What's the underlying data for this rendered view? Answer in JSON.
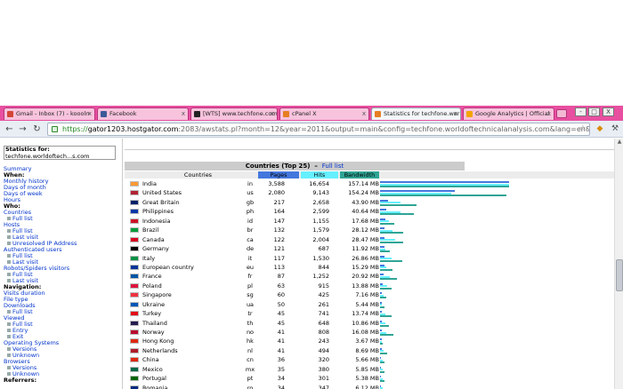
{
  "browser": {
    "tabs": [
      {
        "label": "Gmail - Inbox (7) - koooln",
        "icon": "gmail-icon",
        "color": "#d44638"
      },
      {
        "label": "Facebook",
        "icon": "facebook-icon",
        "color": "#3b5998"
      },
      {
        "label": "[WTS] www.techfone.com",
        "icon": "forum-icon",
        "color": "#222222"
      },
      {
        "label": "cPanel X",
        "icon": "cpanel-icon",
        "color": "#e67e22"
      },
      {
        "label": "Statistics for techfone.worl",
        "icon": "awstats-icon",
        "color": "#e67e22",
        "active": true
      },
      {
        "label": "Google Analytics | Official",
        "icon": "analytics-icon",
        "color": "#f4a400"
      }
    ],
    "url": {
      "scheme": "https://",
      "host": "gator1203.hostgator.com",
      "rest": ":2083/awstats.pl?month=12&year=2011&output=main&config=techfone.worldoftechnicalanalysis.com&lang=en&framename=in"
    },
    "window_controls": [
      "-",
      "□",
      "X"
    ]
  },
  "sidebar": {
    "stats_for_label": "Statistics for:",
    "stats_for_site": "techfone.worldoftech...s.com",
    "items": [
      {
        "text": "Summary",
        "type": "a"
      },
      {
        "text": "When:",
        "type": "h"
      },
      {
        "text": "Monthly history",
        "type": "a"
      },
      {
        "text": "Days of month",
        "type": "a"
      },
      {
        "text": "Days of week",
        "type": "a"
      },
      {
        "text": "Hours",
        "type": "a"
      },
      {
        "text": "Who:",
        "type": "h"
      },
      {
        "text": "Countries",
        "type": "a"
      },
      {
        "text": "Full list",
        "type": "s"
      },
      {
        "text": "Hosts",
        "type": "a"
      },
      {
        "text": "Full list",
        "type": "s"
      },
      {
        "text": "Last visit",
        "type": "s"
      },
      {
        "text": "Unresolved IP Address",
        "type": "s"
      },
      {
        "text": "Authenticated users",
        "type": "a"
      },
      {
        "text": "Full list",
        "type": "s"
      },
      {
        "text": "Last visit",
        "type": "s"
      },
      {
        "text": "Robots/Spiders visitors",
        "type": "a"
      },
      {
        "text": "Full list",
        "type": "s"
      },
      {
        "text": "Last visit",
        "type": "s"
      },
      {
        "text": "Navigation:",
        "type": "h"
      },
      {
        "text": "Visits duration",
        "type": "a"
      },
      {
        "text": "File type",
        "type": "a"
      },
      {
        "text": "Downloads",
        "type": "a"
      },
      {
        "text": "Full list",
        "type": "s"
      },
      {
        "text": "Viewed",
        "type": "a"
      },
      {
        "text": "Full list",
        "type": "s"
      },
      {
        "text": "Entry",
        "type": "s"
      },
      {
        "text": "Exit",
        "type": "s"
      },
      {
        "text": "Operating Systems",
        "type": "a"
      },
      {
        "text": "Versions",
        "type": "s"
      },
      {
        "text": "Unknown",
        "type": "s"
      },
      {
        "text": "Browsers",
        "type": "a"
      },
      {
        "text": "Versions",
        "type": "s"
      },
      {
        "text": "Unknown",
        "type": "s"
      },
      {
        "text": "Referrers:",
        "type": "h"
      }
    ]
  },
  "countries": {
    "title": "Countries (Top 25)",
    "full_list": "Full list",
    "headers": {
      "countries": "Countries",
      "pages": "Pages",
      "hits": "Hits",
      "bandwidth": "Bandwidth"
    },
    "header_colors": {
      "pages": "#4477dd",
      "hits": "#66f0ff",
      "bandwidth": "#2ea495"
    },
    "rows": [
      {
        "name": "India",
        "code": "in",
        "pages": "3,588",
        "hits": "16,654",
        "bw": "157.14 MB",
        "p": 3588,
        "h": 16654,
        "b": 157.14
      },
      {
        "name": "United States",
        "code": "us",
        "pages": "2,080",
        "hits": "9,143",
        "bw": "154.24 MB",
        "p": 2080,
        "h": 9143,
        "b": 154.24
      },
      {
        "name": "Great Britain",
        "code": "gb",
        "pages": "217",
        "hits": "2,658",
        "bw": "43.90 MB",
        "p": 217,
        "h": 2658,
        "b": 43.9
      },
      {
        "name": "Philippines",
        "code": "ph",
        "pages": "164",
        "hits": "2,599",
        "bw": "40.64 MB",
        "p": 164,
        "h": 2599,
        "b": 40.64
      },
      {
        "name": "Indonesia",
        "code": "id",
        "pages": "147",
        "hits": "1,155",
        "bw": "17.68 MB",
        "p": 147,
        "h": 1155,
        "b": 17.68
      },
      {
        "name": "Brazil",
        "code": "br",
        "pages": "132",
        "hits": "1,579",
        "bw": "28.12 MB",
        "p": 132,
        "h": 1579,
        "b": 28.12
      },
      {
        "name": "Canada",
        "code": "ca",
        "pages": "122",
        "hits": "2,004",
        "bw": "28.47 MB",
        "p": 122,
        "h": 2004,
        "b": 28.47
      },
      {
        "name": "Germany",
        "code": "de",
        "pages": "121",
        "hits": "687",
        "bw": "11.92 MB",
        "p": 121,
        "h": 687,
        "b": 11.92
      },
      {
        "name": "Italy",
        "code": "it",
        "pages": "117",
        "hits": "1,530",
        "bw": "26.86 MB",
        "p": 117,
        "h": 1530,
        "b": 26.86
      },
      {
        "name": "European country",
        "code": "eu",
        "pages": "113",
        "hits": "844",
        "bw": "15.29 MB",
        "p": 113,
        "h": 844,
        "b": 15.29
      },
      {
        "name": "France",
        "code": "fr",
        "pages": "87",
        "hits": "1,252",
        "bw": "20.92 MB",
        "p": 87,
        "h": 1252,
        "b": 20.92
      },
      {
        "name": "Poland",
        "code": "pl",
        "pages": "63",
        "hits": "915",
        "bw": "13.88 MB",
        "p": 63,
        "h": 915,
        "b": 13.88
      },
      {
        "name": "Singapore",
        "code": "sg",
        "pages": "60",
        "hits": "425",
        "bw": "7.16 MB",
        "p": 60,
        "h": 425,
        "b": 7.16
      },
      {
        "name": "Ukraine",
        "code": "ua",
        "pages": "50",
        "hits": "261",
        "bw": "5.44 MB",
        "p": 50,
        "h": 261,
        "b": 5.44
      },
      {
        "name": "Turkey",
        "code": "tr",
        "pages": "45",
        "hits": "741",
        "bw": "13.74 MB",
        "p": 45,
        "h": 741,
        "b": 13.74
      },
      {
        "name": "Thailand",
        "code": "th",
        "pages": "45",
        "hits": "648",
        "bw": "10.86 MB",
        "p": 45,
        "h": 648,
        "b": 10.86
      },
      {
        "name": "Norway",
        "code": "no",
        "pages": "41",
        "hits": "808",
        "bw": "16.08 MB",
        "p": 41,
        "h": 808,
        "b": 16.08
      },
      {
        "name": "Hong Kong",
        "code": "hk",
        "pages": "41",
        "hits": "243",
        "bw": "3.67 MB",
        "p": 41,
        "h": 243,
        "b": 3.67
      },
      {
        "name": "Netherlands",
        "code": "nl",
        "pages": "41",
        "hits": "494",
        "bw": "8.69 MB",
        "p": 41,
        "h": 494,
        "b": 8.69
      },
      {
        "name": "China",
        "code": "cn",
        "pages": "36",
        "hits": "320",
        "bw": "5.66 MB",
        "p": 36,
        "h": 320,
        "b": 5.66
      },
      {
        "name": "Mexico",
        "code": "mx",
        "pages": "35",
        "hits": "380",
        "bw": "5.85 MB",
        "p": 35,
        "h": 380,
        "b": 5.85
      },
      {
        "name": "Portugal",
        "code": "pt",
        "pages": "34",
        "hits": "301",
        "bw": "5.38 MB",
        "p": 34,
        "h": 301,
        "b": 5.38
      },
      {
        "name": "Romania",
        "code": "ro",
        "pages": "34",
        "hits": "347",
        "bw": "6.12 MB",
        "p": 34,
        "h": 347,
        "b": 6.12
      }
    ],
    "flag_colors": {
      "in": "#ff9933",
      "us": "#b22234",
      "gb": "#012169",
      "ph": "#0038a8",
      "id": "#ce1126",
      "br": "#009c3b",
      "ca": "#d80621",
      "de": "#000000",
      "it": "#009246",
      "eu": "#003399",
      "fr": "#0055a4",
      "pl": "#dc143c",
      "sg": "#ef3340",
      "ua": "#0057b7",
      "tr": "#e30a17",
      "th": "#241d4f",
      "no": "#ba0c2f",
      "hk": "#de2910",
      "nl": "#ae1c28",
      "cn": "#de2910",
      "mx": "#006847",
      "pt": "#006600",
      "ro": "#002b7f"
    }
  }
}
